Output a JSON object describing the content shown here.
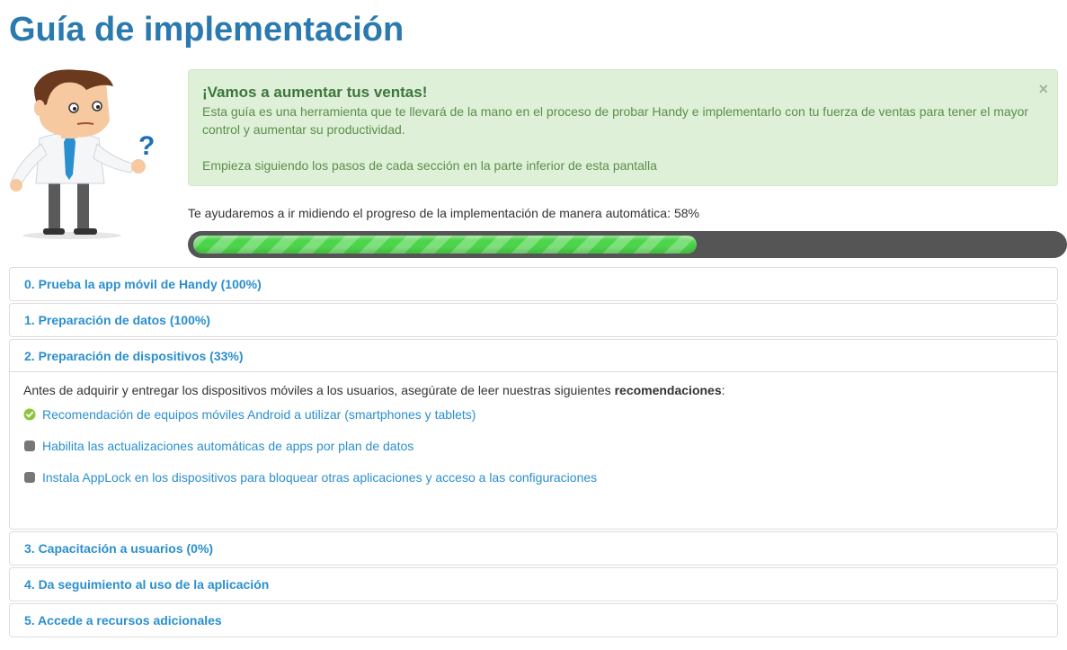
{
  "page": {
    "title": "Guía de implementación"
  },
  "alert": {
    "heading": "¡Vamos a aumentar tus ventas!",
    "text": "Esta guía es una herramienta que te llevará de la mano en el proceso de probar Handy e implementarlo con tu fuerza de ventas para tener el mayor control y aumentar su productividad.",
    "text2": "Empieza siguiendo los pasos de cada sección en la parte inferior de esta pantalla",
    "close_label": "×"
  },
  "progress": {
    "label": "Te ayudaremos a ir midiendo el progreso de la implementación de manera automática:",
    "percent_label": "58%",
    "value": 0.58,
    "fill_color": "#4cd44a",
    "track_color": "#555555"
  },
  "sections": [
    {
      "title": "0. Prueba la app móvil de Handy (100%)"
    },
    {
      "title": "1. Preparación de datos (100%)"
    },
    {
      "title": "2. Preparación de dispositivos (33%)",
      "intro": "Antes de adquirir y entregar los dispositivos móviles a los usuarios, asegúrate de leer nuestras siguientes ",
      "intro_bold": "recomendaciones",
      "intro_end": ":",
      "items": [
        {
          "label": "Recomendación de equipos móviles Android a utilizar (smartphones y tablets)",
          "status": "done",
          "icon": "check-circle-icon"
        },
        {
          "label": "Habilita las actualizaciones automáticas de apps por plan de datos",
          "status": "pending",
          "icon": "square-icon"
        },
        {
          "label": "Instala AppLock en los dispositivos para bloquear otras aplicaciones y acceso a las configuraciones",
          "status": "pending",
          "icon": "square-icon"
        }
      ]
    },
    {
      "title": "3. Capacitación a usuarios (0%)"
    },
    {
      "title": "4. Da seguimiento al uso de la aplicación"
    },
    {
      "title": "5. Accede a recursos adicionales"
    }
  ],
  "colors": {
    "title": "#2a7ab0",
    "link": "#2a8fcf",
    "alert_bg": "#dff0d8",
    "done": "#8cc63f"
  }
}
